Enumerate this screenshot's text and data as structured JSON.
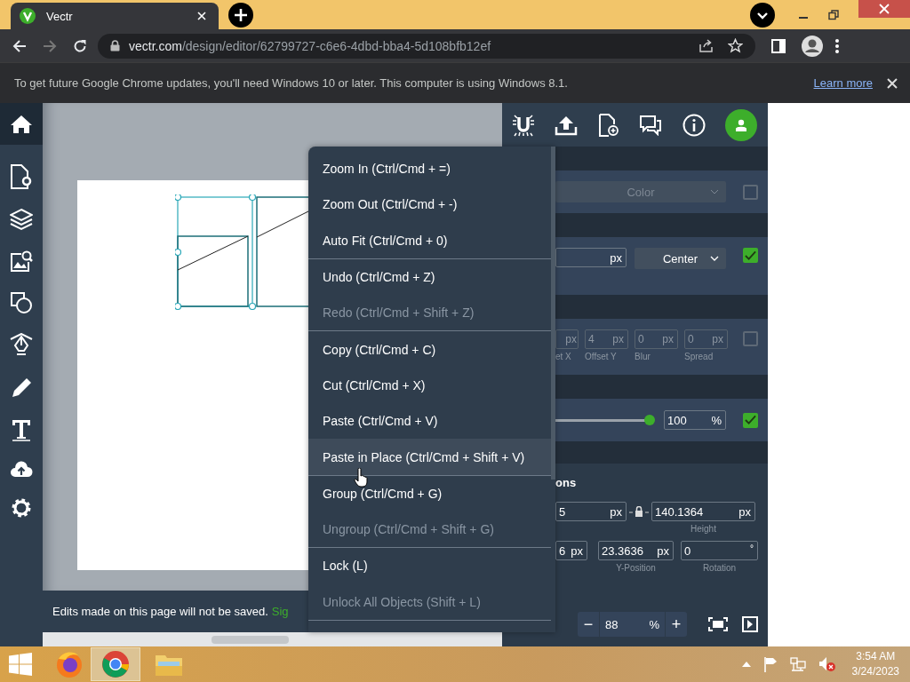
{
  "browser": {
    "tab": {
      "title": "Vectr"
    },
    "url_host": "vectr.com",
    "url_path": "/design/editor/62799727-c6e6-4dbd-bba4-5d108bfb12ef",
    "notice": {
      "text": "To get future Google Chrome updates, you'll need Windows 10 or later. This computer is using Windows 8.1.",
      "link": "Learn more"
    }
  },
  "canvas": {
    "notice": {
      "text": "Edits made on this page will not be saved.",
      "link": "Sig"
    }
  },
  "context_menu": {
    "groups": [
      [
        {
          "label": "Zoom In (Ctrl/Cmd + =)",
          "disabled": false,
          "selected": false
        },
        {
          "label": "Zoom Out (Ctrl/Cmd + -)",
          "disabled": false,
          "selected": false
        },
        {
          "label": "Auto Fit (Ctrl/Cmd + 0)",
          "disabled": false,
          "selected": false
        }
      ],
      [
        {
          "label": "Undo (Ctrl/Cmd + Z)",
          "disabled": false,
          "selected": false
        },
        {
          "label": "Redo (Ctrl/Cmd + Shift + Z)",
          "disabled": true,
          "selected": false
        }
      ],
      [
        {
          "label": "Copy (Ctrl/Cmd + C)",
          "disabled": false,
          "selected": false
        },
        {
          "label": "Cut (Ctrl/Cmd + X)",
          "disabled": false,
          "selected": false
        },
        {
          "label": "Paste (Ctrl/Cmd + V)",
          "disabled": false,
          "selected": false
        },
        {
          "label": "Paste in Place (Ctrl/Cmd + Shift + V)",
          "disabled": false,
          "selected": true
        }
      ],
      [
        {
          "label": "Group (Ctrl/Cmd + G)",
          "disabled": false,
          "selected": false
        },
        {
          "label": "Ungroup (Ctrl/Cmd + Shift + G)",
          "disabled": true,
          "selected": false
        }
      ],
      [
        {
          "label": "Lock (L)",
          "disabled": false,
          "selected": false
        },
        {
          "label": "Unlock All Objects (Shift + L)",
          "disabled": true,
          "selected": false
        }
      ]
    ]
  },
  "panel": {
    "fill": {
      "dropdown": "Color",
      "checked": false
    },
    "stroke": {
      "unit": "px",
      "align": "Center",
      "checked": true
    },
    "shadow": {
      "fields": [
        {
          "unit": "px"
        },
        {
          "value": "4",
          "unit": "px"
        },
        {
          "value": "0",
          "unit": "px"
        },
        {
          "value": "0",
          "unit": "px"
        }
      ],
      "labels": [
        "et X",
        "Offset Y",
        "Blur",
        "Spread"
      ],
      "checked": false
    },
    "opacity": {
      "level": 1,
      "value": "100",
      "unit": "%",
      "checked": true
    },
    "dimensions": {
      "title": "ons",
      "width": {
        "value": "5",
        "unit": "px"
      },
      "height": {
        "value": "140.1364",
        "unit": "px",
        "label": "Height"
      },
      "x": {
        "value": "6",
        "unit": "px"
      },
      "y": {
        "value": "23.3636",
        "unit": "px",
        "label": "Y-Position"
      },
      "rotation": {
        "value": "0",
        "unit": "°",
        "label": "Rotation"
      }
    },
    "zoom": {
      "minus": "−",
      "value": "88",
      "unit": "%",
      "plus": "+"
    }
  },
  "taskbar": {
    "time": "3:54 AM",
    "date": "3/24/2023"
  }
}
